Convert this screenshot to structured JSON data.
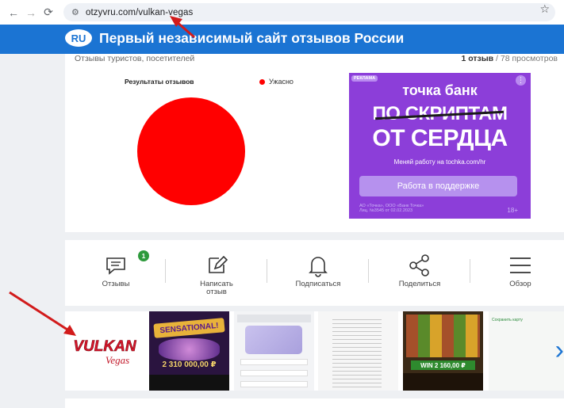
{
  "browser": {
    "url_host": "otzyvru.com",
    "url_path": "/vulkan-vegas"
  },
  "site": {
    "badge": "RU",
    "title": "Первый независимый сайт отзывов России"
  },
  "summary": {
    "subtitle": "Отзывы туристов, посетителей",
    "reviews_count": "1 отзыв",
    "views": " / 78 просмотров"
  },
  "chart_data": {
    "type": "pie",
    "title": "Результаты отзывов",
    "series": [
      {
        "name": "Ужасно",
        "values": [
          1
        ],
        "color": "#ff0000"
      }
    ]
  },
  "ad": {
    "label": "РЕКЛАМА",
    "brand": "точка банк",
    "strike_text": "ПО СКРИПТАМ",
    "headline": "ОТ СЕРДЦА",
    "note": "Меняй работу на tochka.com/hr",
    "button": "Работа в поддержке",
    "legal_line1": "АО «Точка», ООО «Банк Точка»",
    "legal_line2": "Лиц. №3545 от 02.02.2023",
    "age": "18+",
    "color": "#8c3ed9"
  },
  "actions": [
    {
      "label": "Отзывы",
      "icon": "comment-icon",
      "badge": "1"
    },
    {
      "label": "Написать отзыв",
      "icon": "edit-icon"
    },
    {
      "label": "Подписаться",
      "icon": "bell-icon"
    },
    {
      "label": "Поделиться",
      "icon": "share-icon"
    },
    {
      "label": "Обзор",
      "icon": "menu-icon"
    }
  ],
  "gallery": {
    "logo_text": "VULKAN",
    "logo_sub": "Vegas",
    "t2_title": "SENSATIONAL!",
    "t2_amount": "2 310 000,00 ₽",
    "t5_win": "WIN 2 160,00 ₽",
    "t6_text": "Сохранить карту"
  }
}
